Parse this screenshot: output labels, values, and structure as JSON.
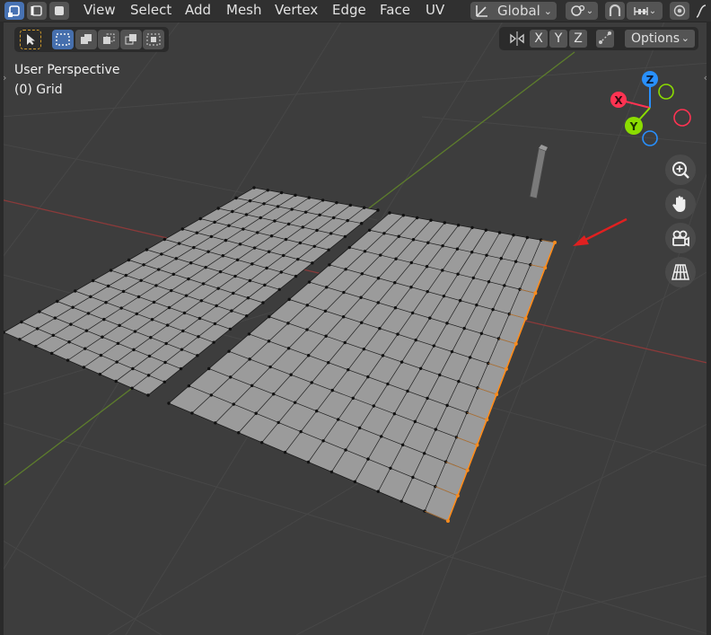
{
  "header": {
    "menus": [
      "View",
      "Select",
      "Add",
      "Mesh",
      "Vertex",
      "Edge",
      "Face",
      "UV"
    ],
    "orientation": "Global"
  },
  "toolbar": {
    "axes": [
      "X",
      "Y",
      "Z"
    ],
    "options_label": "Options"
  },
  "viewport": {
    "view_name": "User Perspective",
    "object_name": "(0) Grid"
  },
  "gizmo": {
    "x_label": "X",
    "y_label": "Y",
    "z_label": "Z",
    "colors": {
      "x": "#ff3352",
      "y": "#8bdc00",
      "z": "#2890ff"
    }
  },
  "icons": [
    "selection-mode-vertex-icon",
    "selection-mode-edge-icon",
    "selection-mode-face-icon",
    "transform-orientation-icon",
    "pivot-icon",
    "snap-icon",
    "proportional-editing-icon",
    "overlay-icon",
    "select-tool-icon",
    "zoom-icon",
    "pan-hand-icon",
    "camera-icon",
    "perspective-grid-icon",
    "mirror-icon"
  ],
  "colors": {
    "background": "#3d3d3d",
    "mesh_face": "#9b9b9b",
    "selection": "#ff8c1a",
    "annotation_arrow": "#e02020"
  }
}
